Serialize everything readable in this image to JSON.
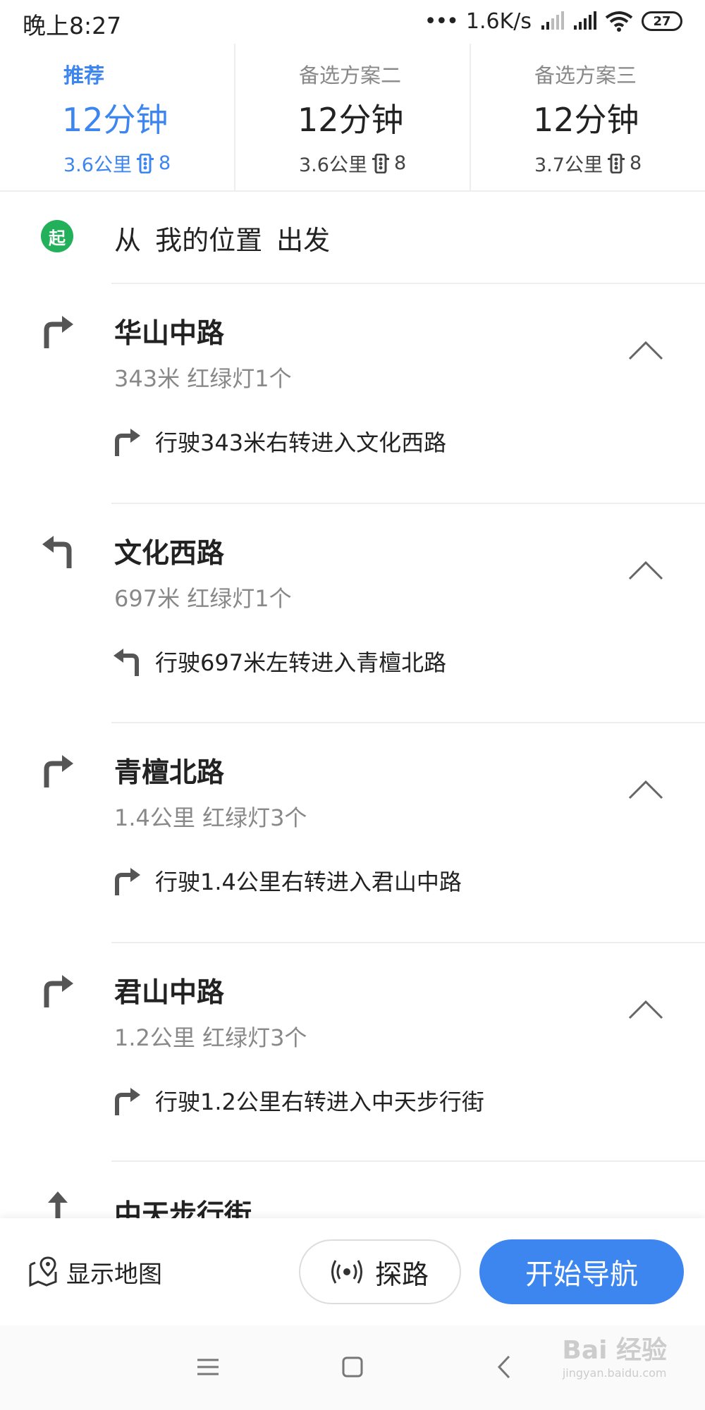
{
  "status_bar": {
    "time": "晚上8:27",
    "net_speed": "1.6K/s",
    "battery": "27"
  },
  "route_options": [
    {
      "label": "推荐",
      "time": "12分钟",
      "distance": "3.6公里",
      "lights": "8",
      "active": true
    },
    {
      "label": "备选方案二",
      "time": "12分钟",
      "distance": "3.6公里",
      "lights": "8",
      "active": false
    },
    {
      "label": "备选方案三",
      "time": "12分钟",
      "distance": "3.7公里",
      "lights": "8",
      "active": false
    }
  ],
  "start": {
    "badge": "起",
    "text": "从 我的位置 出发"
  },
  "steps": [
    {
      "road": "华山中路",
      "summary": "343米 红绿灯1个",
      "instruction": "行驶343米右转进入文化西路",
      "turn": "turn-right-icon"
    },
    {
      "road": "文化西路",
      "summary": "697米 红绿灯1个",
      "instruction": "行驶697米左转进入青檀北路",
      "turn": "turn-left-icon"
    },
    {
      "road": "青檀北路",
      "summary": "1.4公里 红绿灯3个",
      "instruction": "行驶1.4公里右转进入君山中路",
      "turn": "turn-right-icon"
    },
    {
      "road": "君山中路",
      "summary": "1.2公里 红绿灯3个",
      "instruction": "行驶1.2公里右转进入中天步行街",
      "turn": "turn-right-icon"
    }
  ],
  "partial_step": {
    "road": "中天步行街",
    "turn": "straight-icon"
  },
  "actions": {
    "show_map": "显示地图",
    "explore": "探路",
    "start_nav": "开始导航"
  },
  "watermark": {
    "main": "Bai 经验",
    "sub": "jingyan.baidu.com"
  },
  "colors": {
    "accent": "#3d86f0",
    "start_badge": "#22b05a"
  }
}
